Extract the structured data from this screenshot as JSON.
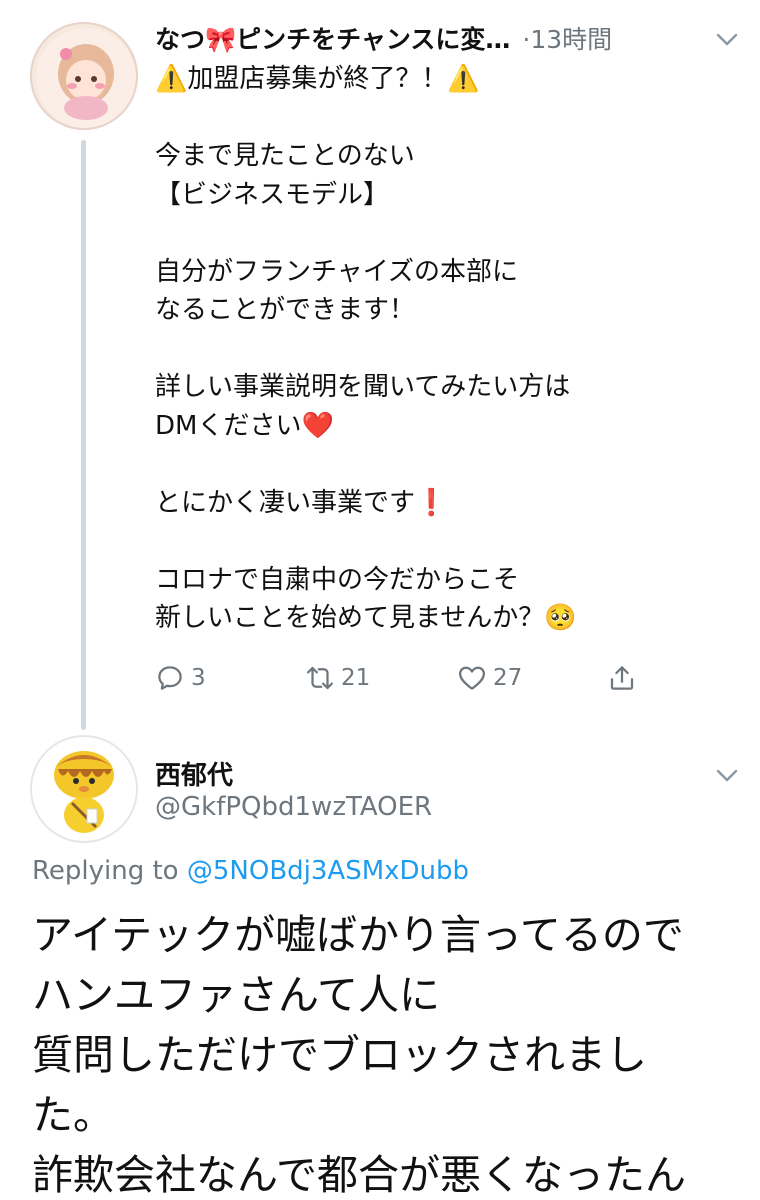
{
  "tweet1": {
    "author_name": "なつ🎀ピンチをチャンスに変…",
    "time": "·13時間",
    "body_lines": [
      "⚠️加盟店募集が終了？！⚠️",
      "",
      "今まで見たことのない",
      "【ビジネスモデル】",
      "",
      "自分がフランチャイズの本部に",
      "なることができます！",
      "",
      "詳しい事業説明を聞いてみたい方は",
      "DMください❤️",
      "",
      "とにかく凄い事業です❗️",
      "",
      "コロナで自粛中の今だからこそ",
      "新しいことを始めて見ませんか？🥺"
    ],
    "actions": {
      "reply_count": "3",
      "retweet_count": "21",
      "like_count": "27"
    }
  },
  "tweet2": {
    "author_name": "西郁代",
    "handle": "@GkfPQbd1wzTAOER",
    "replying_prefix": "Replying to",
    "replying_mention": "@5NOBdj3ASMxDubb",
    "body_lines": [
      "アイテックが嘘ばかり言ってるので",
      "ハンユファさんて人に",
      "質問しただけでブロックされまし",
      "た。",
      "詐欺会社なんで都合が悪くなったん"
    ]
  },
  "colors": {
    "secondary_text": "#6e767d",
    "link": "#1d9bf0",
    "thread_line": "#cfd9de"
  },
  "icons": [
    "chevron-down-icon",
    "reply-icon",
    "retweet-icon",
    "like-icon",
    "share-icon"
  ]
}
